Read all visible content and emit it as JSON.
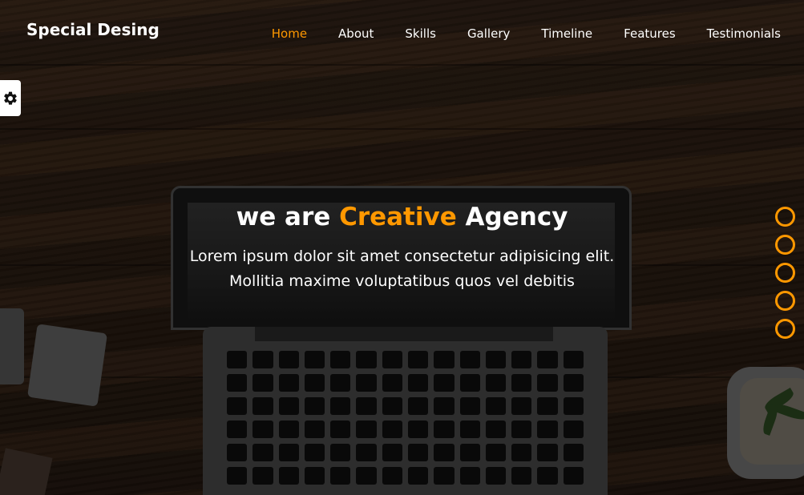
{
  "header": {
    "logo": "Special Desing",
    "nav": [
      {
        "label": "Home",
        "active": true
      },
      {
        "label": "About"
      },
      {
        "label": "Skills"
      },
      {
        "label": "Gallery"
      },
      {
        "label": "Timeline"
      },
      {
        "label": "Features"
      },
      {
        "label": "Testimonials"
      }
    ]
  },
  "settings": {
    "icon": "gear-icon"
  },
  "hero": {
    "title_pre": "we are ",
    "title_accent": "Creative",
    "title_post": " Agency",
    "line1": "Lorem ipsum dolor sit amet consectetur adipisicing elit.",
    "line2": "Mollitia maxime voluptatibus quos vel debitis"
  },
  "bullets": 5,
  "colors": {
    "accent": "#ff9800",
    "text": "#ffffff"
  }
}
